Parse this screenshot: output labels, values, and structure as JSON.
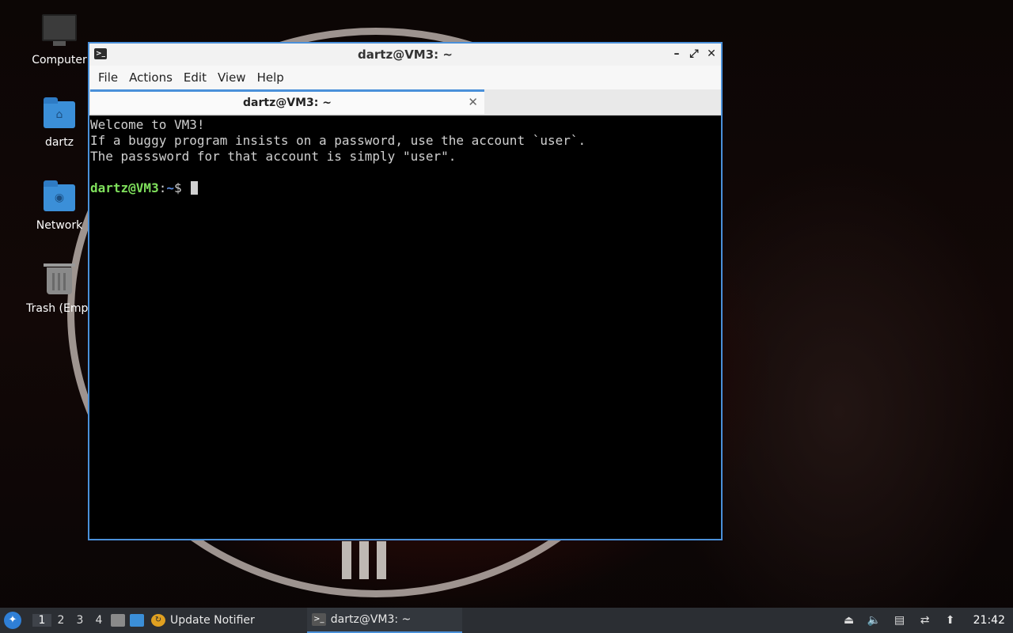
{
  "desktop": {
    "icons": [
      {
        "label": "Computer"
      },
      {
        "label": "dartz"
      },
      {
        "label": "Network"
      },
      {
        "label": "Trash (Empt"
      }
    ]
  },
  "window": {
    "title": "dartz@VM3: ~",
    "controls": {
      "minimize": "–",
      "maximize": "⤢",
      "close": "✕"
    },
    "menu": [
      "File",
      "Actions",
      "Edit",
      "View",
      "Help"
    ],
    "tab": {
      "label": "dartz@VM3: ~",
      "close": "✕"
    },
    "terminal": {
      "lines": [
        "Welcome to VM3!",
        "If a buggy program insists on a password, use the account `user`.",
        "The passsword for that account is simply \"user\"."
      ],
      "prompt_user": "dartz@VM3",
      "prompt_sep": ":",
      "prompt_path": "~",
      "prompt_symbol": "$ "
    }
  },
  "taskbar": {
    "workspaces": [
      "1",
      "2",
      "3",
      "4"
    ],
    "tasks": [
      {
        "label": "Update Notifier"
      },
      {
        "label": "dartz@VM3: ~"
      }
    ],
    "clock": "21:42"
  },
  "colors": {
    "accent": "#4a90d9",
    "prompt_user": "#7fe05c",
    "prompt_path": "#5c8de0"
  }
}
